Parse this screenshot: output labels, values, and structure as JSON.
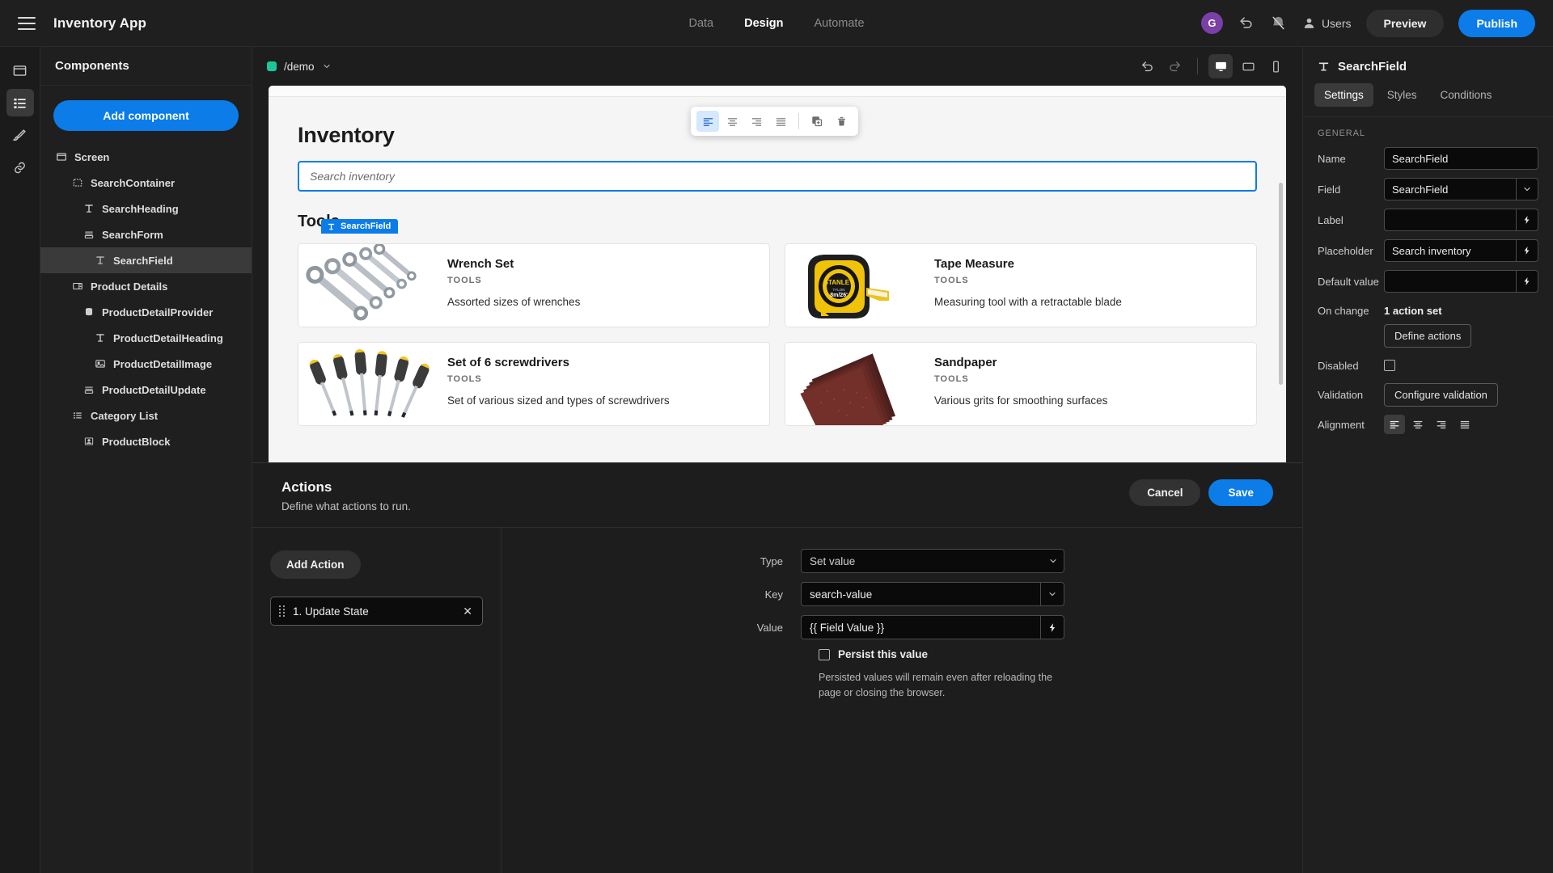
{
  "topbar": {
    "menu_icon": "hamburger-icon",
    "app_title": "Inventory App",
    "nav": [
      {
        "label": "Data",
        "active": false
      },
      {
        "label": "Design",
        "active": true
      },
      {
        "label": "Automate",
        "active": false
      }
    ],
    "avatar_initial": "G",
    "avatar_color": "#7b3fa8",
    "undo_icon": "undo-icon",
    "theme_icon": "theme-off-icon",
    "users_label": "Users",
    "preview_label": "Preview",
    "publish_label": "Publish",
    "publish_color": "#0b7ce8"
  },
  "rail": {
    "items": [
      {
        "icon": "screen-icon",
        "active": false
      },
      {
        "icon": "components-list-icon",
        "active": true
      },
      {
        "icon": "brush-icon",
        "active": false
      },
      {
        "icon": "link-icon",
        "active": false
      }
    ]
  },
  "components": {
    "header": "Components",
    "add_button": "Add component",
    "tree": [
      {
        "label": "Screen",
        "icon": "screen-icon",
        "depth": 0,
        "selected": false
      },
      {
        "label": "SearchContainer",
        "icon": "container-icon",
        "depth": 1,
        "selected": false
      },
      {
        "label": "SearchHeading",
        "icon": "text-icon",
        "depth": 2,
        "selected": false
      },
      {
        "label": "SearchForm",
        "icon": "form-icon",
        "depth": 2,
        "selected": false
      },
      {
        "label": "SearchField",
        "icon": "text-icon",
        "depth": 3,
        "selected": true
      },
      {
        "label": "Product Details",
        "icon": "sidepanel-icon",
        "depth": 1,
        "selected": false
      },
      {
        "label": "ProductDetailProvider",
        "icon": "database-icon",
        "depth": 2,
        "selected": false
      },
      {
        "label": "ProductDetailHeading",
        "icon": "text-icon",
        "depth": 3,
        "selected": false
      },
      {
        "label": "ProductDetailImage",
        "icon": "image-icon",
        "depth": 3,
        "selected": false
      },
      {
        "label": "ProductDetailUpdate",
        "icon": "form-icon",
        "depth": 2,
        "selected": false
      },
      {
        "label": "Category List",
        "icon": "list-icon",
        "depth": 1,
        "selected": false
      },
      {
        "label": "ProductBlock",
        "icon": "block-icon",
        "depth": 2,
        "selected": false
      }
    ]
  },
  "canvas": {
    "route_label": "/demo",
    "route_dot_color": "#19c79a",
    "undo_icon": "undo-icon",
    "redo_icon": "redo-icon",
    "devices": [
      {
        "icon": "desktop-icon",
        "active": true
      },
      {
        "icon": "tablet-icon",
        "active": false
      },
      {
        "icon": "mobile-icon",
        "active": false
      }
    ],
    "align_toolbar": [
      {
        "icon": "align-left-icon",
        "active": true
      },
      {
        "icon": "align-center-icon",
        "active": false
      },
      {
        "icon": "align-right-icon",
        "active": false
      },
      {
        "icon": "align-justify-icon",
        "active": false
      },
      {
        "icon": "duplicate-icon",
        "active": false
      },
      {
        "icon": "trash-icon",
        "active": false
      }
    ],
    "page_title": "Inventory",
    "selection_badge": "SearchField",
    "search_placeholder": "Search inventory",
    "section_title": "Tools",
    "cards": [
      {
        "title": "Wrench Set",
        "category": "TOOLS",
        "description": "Assorted sizes of wrenches",
        "image": "wrench-set-photo"
      },
      {
        "title": "Tape Measure",
        "category": "TOOLS",
        "description": "Measuring tool with a retractable blade",
        "image": "tape-measure-photo"
      },
      {
        "title": "Set of 6 screwdrivers",
        "category": "TOOLS",
        "description": "Set of various sized and types of screwdrivers",
        "image": "screwdrivers-photo"
      },
      {
        "title": "Sandpaper",
        "category": "TOOLS",
        "description": "Various grits for smoothing surfaces",
        "image": "sandpaper-photo"
      }
    ]
  },
  "properties": {
    "icon": "text-field-icon",
    "title": "SearchField",
    "tabs": [
      {
        "label": "Settings",
        "active": true
      },
      {
        "label": "Styles",
        "active": false
      },
      {
        "label": "Conditions",
        "active": false
      }
    ],
    "group_label": "GENERAL",
    "name_label": "Name",
    "name_value": "SearchField",
    "field_label": "Field",
    "field_value": "SearchField",
    "label_label": "Label",
    "label_value": "",
    "placeholder_label": "Placeholder",
    "placeholder_value": "Search inventory",
    "default_label": "Default value",
    "default_value": "",
    "onchange_label": "On change",
    "onchange_value": "1 action set",
    "define_actions_label": "Define actions",
    "disabled_label": "Disabled",
    "disabled_checked": false,
    "validation_label": "Validation",
    "configure_validation_label": "Configure validation",
    "alignment_label": "Alignment",
    "alignment_options": [
      {
        "icon": "align-left-icon",
        "active": true
      },
      {
        "icon": "align-center-icon",
        "active": false
      },
      {
        "icon": "align-right-icon",
        "active": false
      },
      {
        "icon": "align-justify-icon",
        "active": false
      }
    ]
  },
  "actions_drawer": {
    "title": "Actions",
    "subtitle": "Define what actions to run.",
    "cancel_label": "Cancel",
    "save_label": "Save",
    "add_action_label": "Add Action",
    "action_items": [
      {
        "label": "1. Update State",
        "close_icon": "close-icon"
      }
    ],
    "type_label": "Type",
    "type_value": "Set value",
    "key_label": "Key",
    "key_value": "search-value",
    "value_label": "Value",
    "value_value": "{{ Field Value }}",
    "persist_label": "Persist this value",
    "persist_checked": false,
    "persist_help": "Persisted values will remain even after reloading the page or closing the browser."
  }
}
